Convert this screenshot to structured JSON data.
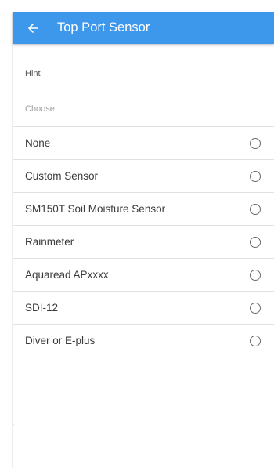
{
  "appbar": {
    "title": "Top Port Sensor",
    "back_icon": "arrow-left-icon",
    "color": "#3d97ea"
  },
  "form": {
    "hint": "Hint",
    "placeholder": "Choose"
  },
  "options": [
    {
      "label": "None",
      "selected": false
    },
    {
      "label": "Custom Sensor",
      "selected": false
    },
    {
      "label": "SM150T Soil Moisture Sensor",
      "selected": false
    },
    {
      "label": "Rainmeter",
      "selected": false
    },
    {
      "label": "Aquaread APxxxx",
      "selected": false
    },
    {
      "label": "SDI-12",
      "selected": false
    },
    {
      "label": "Diver or E-plus",
      "selected": false
    }
  ]
}
